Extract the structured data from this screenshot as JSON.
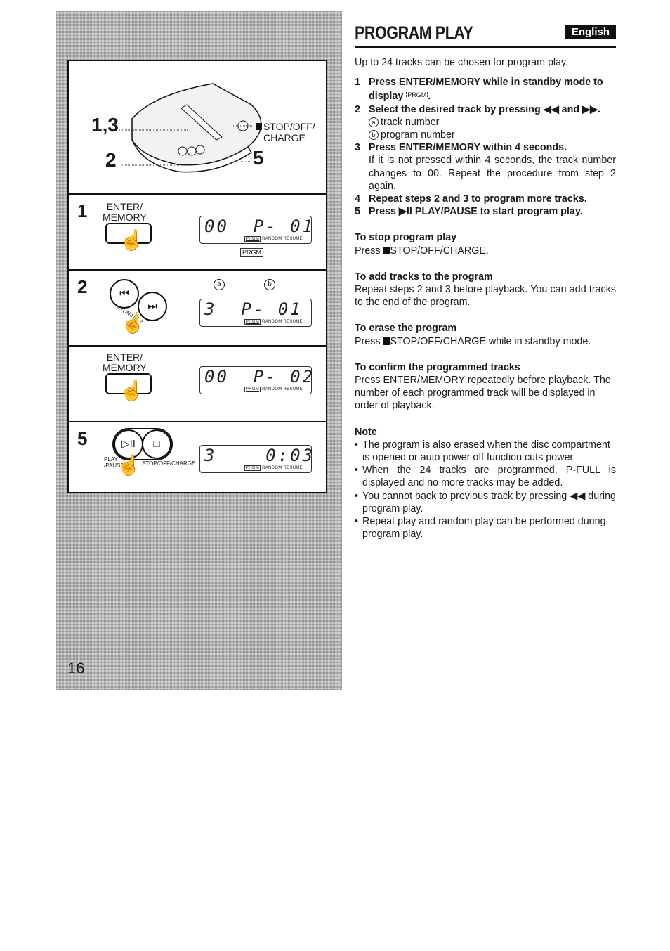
{
  "header": {
    "title": "PROGRAM PLAY",
    "language_badge": "English"
  },
  "intro": "Up to 24 tracks can be chosen for program play.",
  "steps": [
    {
      "num": "1",
      "heading": "Press ENTER/MEMORY while in standby mode to display",
      "indicator": "PRGM",
      "heading_end": "."
    },
    {
      "num": "2",
      "heading": "Select the desired track by pressing ◀◀ and ▶▶.",
      "items": [
        {
          "marker": "a",
          "text": "track number"
        },
        {
          "marker": "b",
          "text": "program number"
        }
      ]
    },
    {
      "num": "3",
      "heading": "Press ENTER/MEMORY within 4 seconds.",
      "body": "If it is not pressed within 4 seconds, the track number changes to 00. Repeat the procedure from step 2 again."
    },
    {
      "num": "4",
      "heading": "Repeat steps 2 and 3 to program more tracks."
    },
    {
      "num": "5",
      "heading": "Press ▶II PLAY/PAUSE to start program play."
    }
  ],
  "sections": [
    {
      "heading": "To stop program play",
      "text": "Press",
      "button": "STOP/OFF/CHARGE",
      "text_end": "."
    },
    {
      "heading": "To add tracks to the program",
      "text": "Repeat steps 2 and 3 before playback. You can add tracks to the end of the program."
    },
    {
      "heading": "To erase the program",
      "text": "Press",
      "button": "STOP/OFF/CHARGE",
      "text_end": " while in standby mode."
    },
    {
      "heading": "To confirm the programmed tracks",
      "text": "Press ENTER/MEMORY repeatedly before playback. The number of each programmed track will be displayed in order of playback."
    }
  ],
  "note": {
    "heading": "Note",
    "bullets": [
      "The program is also erased when the disc compartment is opened or auto power off function cuts power.",
      "When the 24 tracks are programmed, P-FULL is displayed and no more tracks may be added.",
      "You cannot back to previous track by pressing ◀◀ during program play.",
      "Repeat play and random play can be performed during program play."
    ]
  },
  "figure": {
    "overview": {
      "callout_13": "1,3",
      "callout_2": "2",
      "callout_5": "5",
      "stop_label_line1": "STOP/OFF/",
      "stop_label_line2": "CHARGE"
    },
    "panels": [
      {
        "step": "1",
        "button_line1": "ENTER/",
        "button_line2": "MEMORY",
        "display": "00  P- 01",
        "indicator_below": "PRGM"
      },
      {
        "step": "2",
        "tuning_label": "- TUNING +",
        "marker_a": "a",
        "marker_b": "b",
        "display": "3  P- 01"
      },
      {
        "step": "",
        "button_line1": "ENTER/",
        "button_line2": "MEMORY",
        "display": "00  P- 02"
      },
      {
        "step": "5",
        "play_label_line1": "PLAY",
        "play_label_line2": "/PAUSE",
        "stop_label": "STOP/OFF/CHARGE",
        "play_glyph": "▷II",
        "stop_glyph": "□",
        "display": "3    0:03"
      }
    ],
    "lcd_indicators": {
      "prgm": "PRGM",
      "random": "RANDOM",
      "resume": "RESUME"
    },
    "prev_glyph": "⏮",
    "next_glyph": "⏭"
  },
  "page_number": "16"
}
